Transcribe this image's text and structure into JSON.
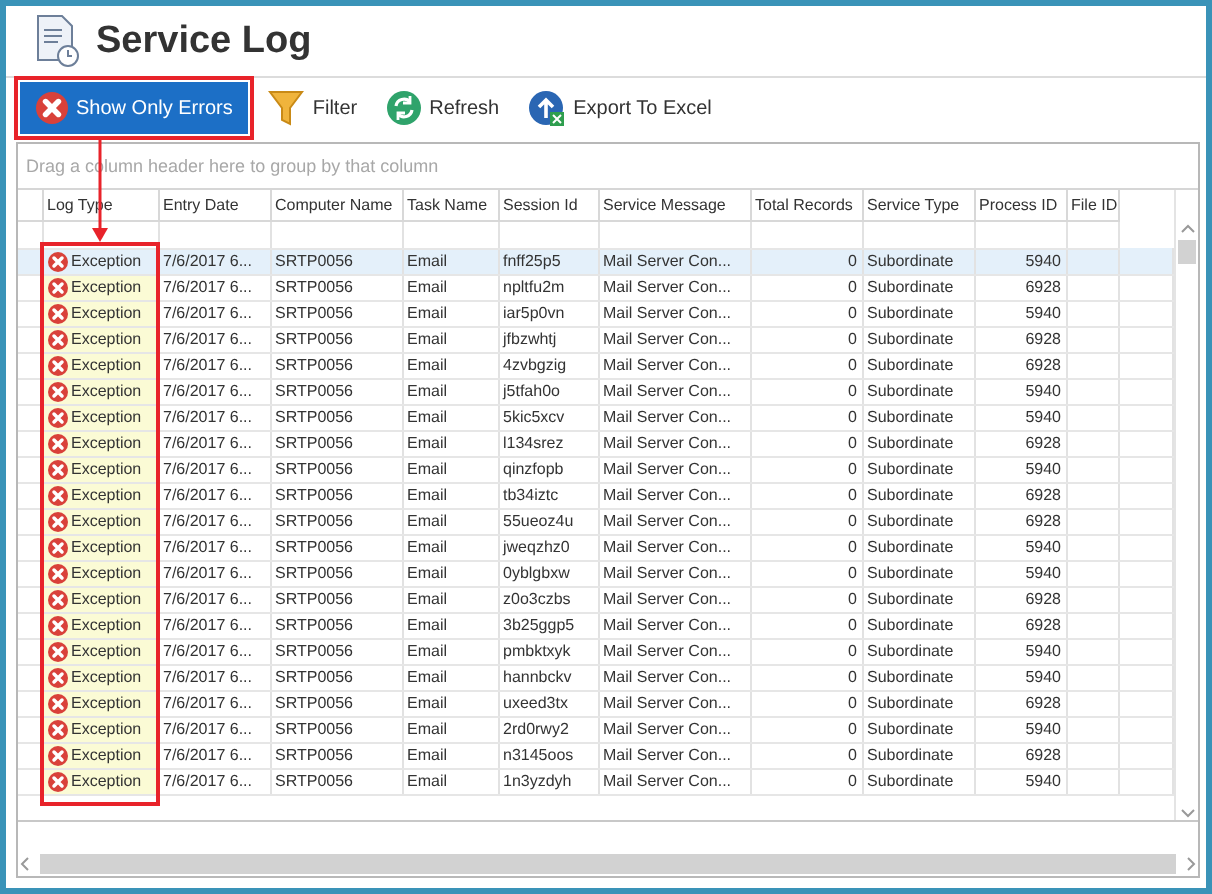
{
  "window": {
    "title": "Service Log"
  },
  "toolbar": [
    {
      "kind": "errors",
      "label": "Show Only Errors",
      "pressed": true
    },
    {
      "kind": "filter",
      "label": "Filter",
      "pressed": false
    },
    {
      "kind": "refresh",
      "label": "Refresh",
      "pressed": false
    },
    {
      "kind": "export",
      "label": "Export To Excel",
      "pressed": false
    }
  ],
  "grid": {
    "group_panel_hint": "Drag a column header here to group by that column",
    "columns": [
      {
        "label": "Log Type"
      },
      {
        "label": "Entry Date"
      },
      {
        "label": "Computer Name"
      },
      {
        "label": "Task Name"
      },
      {
        "label": "Session Id"
      },
      {
        "label": "Service Message"
      },
      {
        "label": "Total Records"
      },
      {
        "label": "Service Type"
      },
      {
        "label": "Process ID"
      },
      {
        "label": "File ID"
      }
    ],
    "rows": [
      {
        "selected": true,
        "cells": [
          "Exception",
          "7/6/2017 6...",
          "SRTP0056",
          "Email",
          "fnff25p5",
          "Mail Server Con...",
          "0",
          "Subordinate",
          "5940"
        ]
      },
      {
        "selected": false,
        "cells": [
          "Exception",
          "7/6/2017 6...",
          "SRTP0056",
          "Email",
          "npltfu2m",
          "Mail Server Con...",
          "0",
          "Subordinate",
          "6928"
        ]
      },
      {
        "selected": false,
        "cells": [
          "Exception",
          "7/6/2017 6...",
          "SRTP0056",
          "Email",
          "iar5p0vn",
          "Mail Server Con...",
          "0",
          "Subordinate",
          "5940"
        ]
      },
      {
        "selected": false,
        "cells": [
          "Exception",
          "7/6/2017 6...",
          "SRTP0056",
          "Email",
          "jfbzwhtj",
          "Mail Server Con...",
          "0",
          "Subordinate",
          "6928"
        ]
      },
      {
        "selected": false,
        "cells": [
          "Exception",
          "7/6/2017 6...",
          "SRTP0056",
          "Email",
          "4zvbgzig",
          "Mail Server Con...",
          "0",
          "Subordinate",
          "6928"
        ]
      },
      {
        "selected": false,
        "cells": [
          "Exception",
          "7/6/2017 6...",
          "SRTP0056",
          "Email",
          "j5tfah0o",
          "Mail Server Con...",
          "0",
          "Subordinate",
          "5940"
        ]
      },
      {
        "selected": false,
        "cells": [
          "Exception",
          "7/6/2017 6...",
          "SRTP0056",
          "Email",
          "5kic5xcv",
          "Mail Server Con...",
          "0",
          "Subordinate",
          "5940"
        ]
      },
      {
        "selected": false,
        "cells": [
          "Exception",
          "7/6/2017 6...",
          "SRTP0056",
          "Email",
          "l134srez",
          "Mail Server Con...",
          "0",
          "Subordinate",
          "6928"
        ]
      },
      {
        "selected": false,
        "cells": [
          "Exception",
          "7/6/2017 6...",
          "SRTP0056",
          "Email",
          "qinzfopb",
          "Mail Server Con...",
          "0",
          "Subordinate",
          "5940"
        ]
      },
      {
        "selected": false,
        "cells": [
          "Exception",
          "7/6/2017 6...",
          "SRTP0056",
          "Email",
          "tb34iztc",
          "Mail Server Con...",
          "0",
          "Subordinate",
          "6928"
        ]
      },
      {
        "selected": false,
        "cells": [
          "Exception",
          "7/6/2017 6...",
          "SRTP0056",
          "Email",
          "55ueoz4u",
          "Mail Server Con...",
          "0",
          "Subordinate",
          "6928"
        ]
      },
      {
        "selected": false,
        "cells": [
          "Exception",
          "7/6/2017 6...",
          "SRTP0056",
          "Email",
          "jweqzhz0",
          "Mail Server Con...",
          "0",
          "Subordinate",
          "5940"
        ]
      },
      {
        "selected": false,
        "cells": [
          "Exception",
          "7/6/2017 6...",
          "SRTP0056",
          "Email",
          "0yblgbxw",
          "Mail Server Con...",
          "0",
          "Subordinate",
          "5940"
        ]
      },
      {
        "selected": false,
        "cells": [
          "Exception",
          "7/6/2017 6...",
          "SRTP0056",
          "Email",
          "z0o3czbs",
          "Mail Server Con...",
          "0",
          "Subordinate",
          "6928"
        ]
      },
      {
        "selected": false,
        "cells": [
          "Exception",
          "7/6/2017 6...",
          "SRTP0056",
          "Email",
          "3b25ggp5",
          "Mail Server Con...",
          "0",
          "Subordinate",
          "6928"
        ]
      },
      {
        "selected": false,
        "cells": [
          "Exception",
          "7/6/2017 6...",
          "SRTP0056",
          "Email",
          "pmbktxyk",
          "Mail Server Con...",
          "0",
          "Subordinate",
          "5940"
        ]
      },
      {
        "selected": false,
        "cells": [
          "Exception",
          "7/6/2017 6...",
          "SRTP0056",
          "Email",
          "hannbckv",
          "Mail Server Con...",
          "0",
          "Subordinate",
          "5940"
        ]
      },
      {
        "selected": false,
        "cells": [
          "Exception",
          "7/6/2017 6...",
          "SRTP0056",
          "Email",
          "uxeed3tx",
          "Mail Server Con...",
          "0",
          "Subordinate",
          "6928"
        ]
      },
      {
        "selected": false,
        "cells": [
          "Exception",
          "7/6/2017 6...",
          "SRTP0056",
          "Email",
          "2rd0rwy2",
          "Mail Server Con...",
          "0",
          "Subordinate",
          "5940"
        ]
      },
      {
        "selected": false,
        "cells": [
          "Exception",
          "7/6/2017 6...",
          "SRTP0056",
          "Email",
          "n3145oos",
          "Mail Server Con...",
          "0",
          "Subordinate",
          "6928"
        ]
      },
      {
        "selected": false,
        "cells": [
          "Exception",
          "7/6/2017 6...",
          "SRTP0056",
          "Email",
          "1n3yzdyh",
          "Mail Server Con...",
          "0",
          "Subordinate",
          "5940"
        ]
      }
    ]
  }
}
